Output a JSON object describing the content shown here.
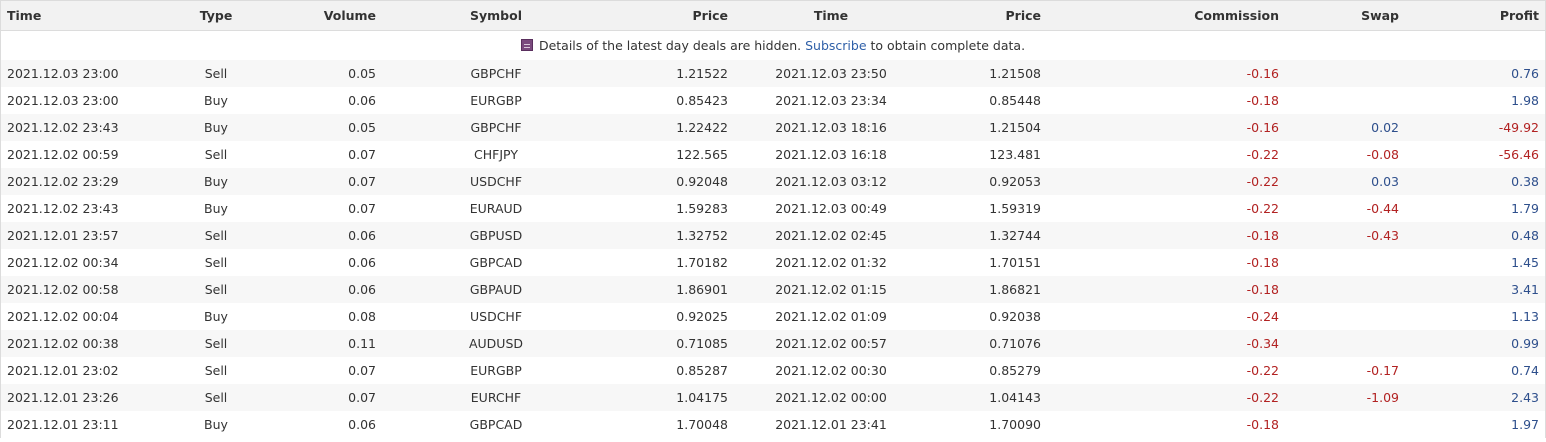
{
  "headers": [
    "Time",
    "Type",
    "Volume",
    "Symbol",
    "Price",
    "Time",
    "Price",
    "Commission",
    "Swap",
    "Profit"
  ],
  "notice": {
    "before": "Details of the latest day deals are hidden.",
    "link": "Subscribe",
    "after": "to obtain complete data."
  },
  "rows": [
    {
      "open_time": "2021.12.03 23:00",
      "type": "Sell",
      "volume": "0.05",
      "symbol": "GBPCHF",
      "open_price": "1.21522",
      "close_time": "2021.12.03 23:50",
      "close_price": "1.21508",
      "commission": "-0.16",
      "swap": "",
      "profit": "0.76"
    },
    {
      "open_time": "2021.12.03 23:00",
      "type": "Buy",
      "volume": "0.06",
      "symbol": "EURGBP",
      "open_price": "0.85423",
      "close_time": "2021.12.03 23:34",
      "close_price": "0.85448",
      "commission": "-0.18",
      "swap": "",
      "profit": "1.98"
    },
    {
      "open_time": "2021.12.02 23:43",
      "type": "Buy",
      "volume": "0.05",
      "symbol": "GBPCHF",
      "open_price": "1.22422",
      "close_time": "2021.12.03 18:16",
      "close_price": "1.21504",
      "commission": "-0.16",
      "swap": "0.02",
      "profit": "-49.92"
    },
    {
      "open_time": "2021.12.02 00:59",
      "type": "Sell",
      "volume": "0.07",
      "symbol": "CHFJPY",
      "open_price": "122.565",
      "close_time": "2021.12.03 16:18",
      "close_price": "123.481",
      "commission": "-0.22",
      "swap": "-0.08",
      "profit": "-56.46"
    },
    {
      "open_time": "2021.12.02 23:29",
      "type": "Buy",
      "volume": "0.07",
      "symbol": "USDCHF",
      "open_price": "0.92048",
      "close_time": "2021.12.03 03:12",
      "close_price": "0.92053",
      "commission": "-0.22",
      "swap": "0.03",
      "profit": "0.38"
    },
    {
      "open_time": "2021.12.02 23:43",
      "type": "Buy",
      "volume": "0.07",
      "symbol": "EURAUD",
      "open_price": "1.59283",
      "close_time": "2021.12.03 00:49",
      "close_price": "1.59319",
      "commission": "-0.22",
      "swap": "-0.44",
      "profit": "1.79"
    },
    {
      "open_time": "2021.12.01 23:57",
      "type": "Sell",
      "volume": "0.06",
      "symbol": "GBPUSD",
      "open_price": "1.32752",
      "close_time": "2021.12.02 02:45",
      "close_price": "1.32744",
      "commission": "-0.18",
      "swap": "-0.43",
      "profit": "0.48"
    },
    {
      "open_time": "2021.12.02 00:34",
      "type": "Sell",
      "volume": "0.06",
      "symbol": "GBPCAD",
      "open_price": "1.70182",
      "close_time": "2021.12.02 01:32",
      "close_price": "1.70151",
      "commission": "-0.18",
      "swap": "",
      "profit": "1.45"
    },
    {
      "open_time": "2021.12.02 00:58",
      "type": "Sell",
      "volume": "0.06",
      "symbol": "GBPAUD",
      "open_price": "1.86901",
      "close_time": "2021.12.02 01:15",
      "close_price": "1.86821",
      "commission": "-0.18",
      "swap": "",
      "profit": "3.41"
    },
    {
      "open_time": "2021.12.02 00:04",
      "type": "Buy",
      "volume": "0.08",
      "symbol": "USDCHF",
      "open_price": "0.92025",
      "close_time": "2021.12.02 01:09",
      "close_price": "0.92038",
      "commission": "-0.24",
      "swap": "",
      "profit": "1.13"
    },
    {
      "open_time": "2021.12.02 00:38",
      "type": "Sell",
      "volume": "0.11",
      "symbol": "AUDUSD",
      "open_price": "0.71085",
      "close_time": "2021.12.02 00:57",
      "close_price": "0.71076",
      "commission": "-0.34",
      "swap": "",
      "profit": "0.99"
    },
    {
      "open_time": "2021.12.01 23:02",
      "type": "Sell",
      "volume": "0.07",
      "symbol": "EURGBP",
      "open_price": "0.85287",
      "close_time": "2021.12.02 00:30",
      "close_price": "0.85279",
      "commission": "-0.22",
      "swap": "-0.17",
      "profit": "0.74"
    },
    {
      "open_time": "2021.12.01 23:26",
      "type": "Sell",
      "volume": "0.07",
      "symbol": "EURCHF",
      "open_price": "1.04175",
      "close_time": "2021.12.02 00:00",
      "close_price": "1.04143",
      "commission": "-0.22",
      "swap": "-1.09",
      "profit": "2.43"
    },
    {
      "open_time": "2021.12.01 23:11",
      "type": "Buy",
      "volume": "0.06",
      "symbol": "GBPCAD",
      "open_price": "1.70048",
      "close_time": "2021.12.01 23:41",
      "close_price": "1.70090",
      "commission": "-0.18",
      "swap": "",
      "profit": "1.97"
    }
  ],
  "colors": {
    "negative": "#b22222",
    "positive": "#2e4f8c",
    "link": "#2e5fa8",
    "header_bg": "#f2f2f2",
    "row_alt_bg": "#f7f7f7"
  },
  "icons": {
    "notice": "lock-icon"
  }
}
